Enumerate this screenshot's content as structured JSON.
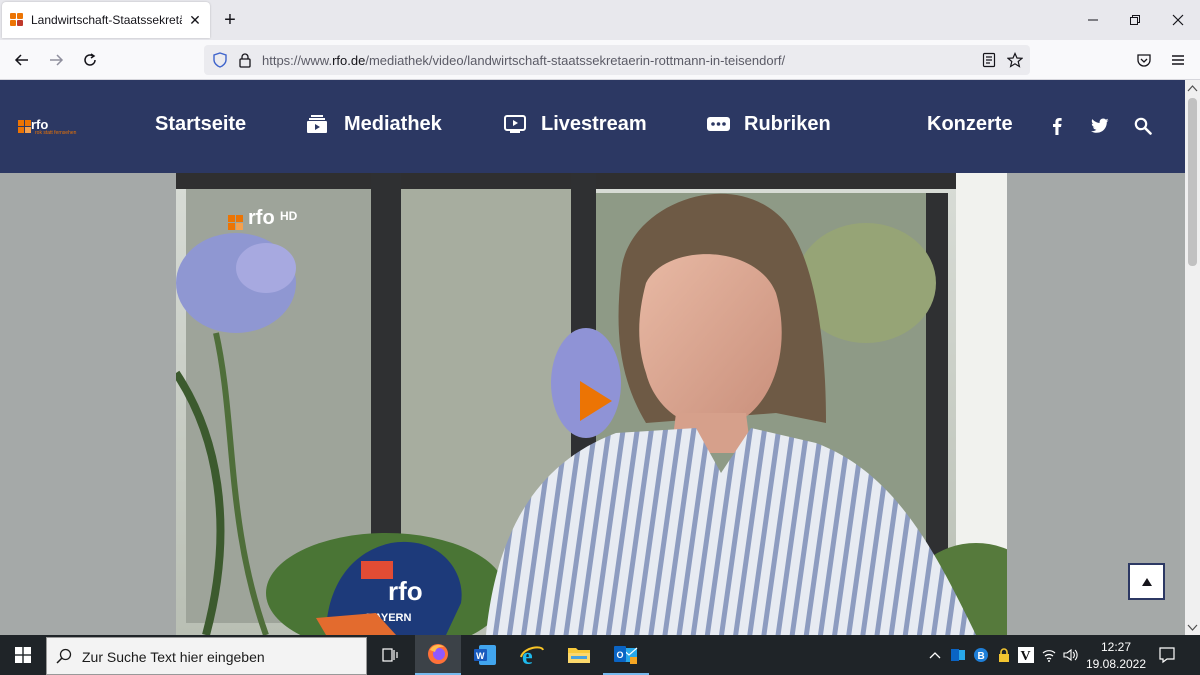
{
  "browser": {
    "tab_title": "Landwirtschaft-Staatssekretärin",
    "url_prefix": "https://www.",
    "url_domain": "rfo.de",
    "url_path": "/mediathek/video/landwirtschaft-staatssekretaerin-rottmann-in-teisendorf/"
  },
  "site": {
    "logo_text": "rfo",
    "logo_tagline": "rok statt fernsehen",
    "nav": [
      {
        "label": "Startseite"
      },
      {
        "label": "Mediathek"
      },
      {
        "label": "Livestream"
      },
      {
        "label": "Rubriken"
      },
      {
        "label": "Konzerte"
      }
    ],
    "brand_color": "#2c3863",
    "accent_color": "#ec7404"
  },
  "video": {
    "watermark": "rfo",
    "watermark_hd": "HD",
    "mic_label": "rfo",
    "mic_sub": "BAYERN"
  },
  "taskbar": {
    "search_placeholder": "Zur Suche Text hier eingeben",
    "time": "12:27",
    "date": "19.08.2022"
  }
}
